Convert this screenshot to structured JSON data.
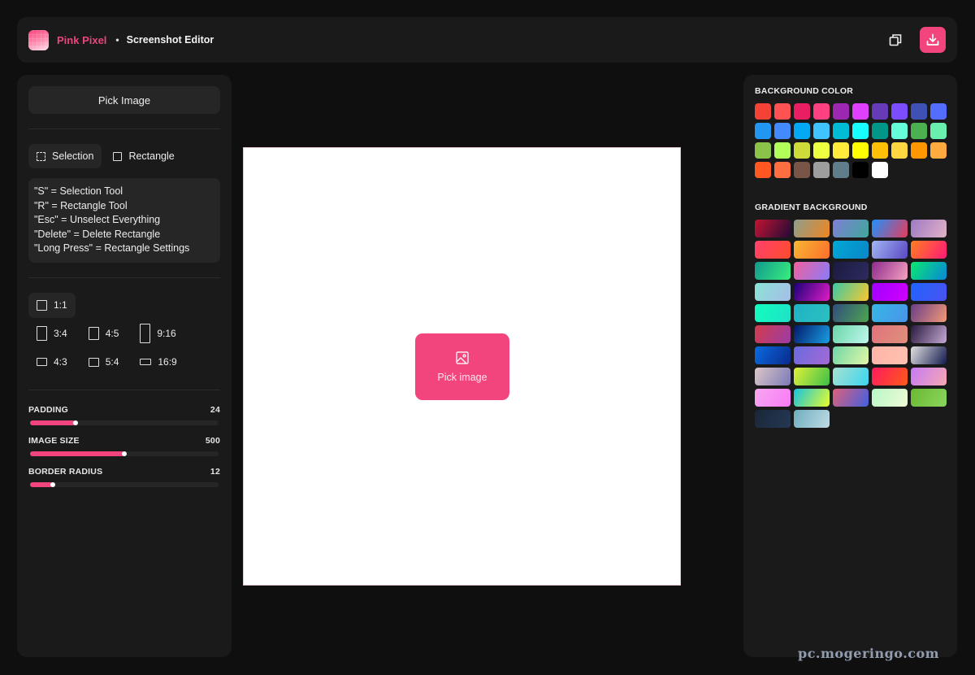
{
  "header": {
    "brand": "Pink Pixel",
    "separator": "•",
    "subtitle": "Screenshot Editor",
    "actions": [
      {
        "name": "copy-button",
        "icon": "copy-icon"
      },
      {
        "name": "download-button",
        "icon": "download-icon"
      }
    ]
  },
  "left_panel": {
    "pick_image_label": "Pick Image",
    "tools": [
      {
        "label": "Selection",
        "icon": "selection-icon",
        "active": true
      },
      {
        "label": "Rectangle",
        "icon": "rectangle-icon",
        "active": false
      }
    ],
    "shortcuts": [
      "\"S\" = Selection Tool",
      "\"R\" = Rectangle Tool",
      "\"Esc\" = Unselect Everything",
      "\"Delete\" = Delete Rectangle",
      "\"Long Press\" = Rectangle Settings"
    ],
    "aspect_ratios": [
      {
        "label": "1:1",
        "active": true
      },
      {
        "label": "3:4",
        "active": false
      },
      {
        "label": "4:5",
        "active": false
      },
      {
        "label": "9:16",
        "active": false
      },
      {
        "label": "4:3",
        "active": false
      },
      {
        "label": "5:4",
        "active": false
      },
      {
        "label": "16:9",
        "active": false
      }
    ],
    "sliders": [
      {
        "label": "PADDING",
        "value": "24",
        "fraction": 0.24
      },
      {
        "label": "IMAGE SIZE",
        "value": "500",
        "fraction": 0.5
      },
      {
        "label": "BORDER RADIUS",
        "value": "12",
        "fraction": 0.12
      }
    ]
  },
  "canvas": {
    "pick_label": "Pick image",
    "icon": "image-icon"
  },
  "right_panel": {
    "background_color_title": "BACKGROUND COLOR",
    "colors": [
      "#f44336",
      "#ff5252",
      "#e91e63",
      "#ff4081",
      "#9c27b0",
      "#e040fb",
      "#673ab7",
      "#7c4dff",
      "#3f51b5",
      "#536dfe",
      "#2196f3",
      "#448aff",
      "#03a9f4",
      "#40c4ff",
      "#00bcd4",
      "#18ffff",
      "#009688",
      "#64ffda",
      "#4caf50",
      "#69f0ae",
      "#8bc34a",
      "#b2ff59",
      "#cddc39",
      "#eeff41",
      "#ffeb3b",
      "#ffff00",
      "#ffc107",
      "#ffd740",
      "#ff9800",
      "#ffab40",
      "#ff5722",
      "#ff6e40",
      "#795548",
      "#9e9e9e",
      "#607d8b",
      "#000000",
      "#ffffff"
    ],
    "gradient_title": "GRADIENT BACKGROUND",
    "gradients": [
      [
        "#c31432",
        "#240b36"
      ],
      [
        "#8e9e8e",
        "#f0851f"
      ],
      [
        "#7f7fd5",
        "#3ea89a"
      ],
      [
        "#1e90ff",
        "#e73c5a"
      ],
      [
        "#9d7ac3",
        "#e3b2c8"
      ],
      [
        "#ff416c",
        "#ff4b2b"
      ],
      [
        "#f7b733",
        "#fc6e2b"
      ],
      [
        "#00a8d6",
        "#0b86c7"
      ],
      [
        "#a0b6f5",
        "#5b48c2"
      ],
      [
        "#ff7e20",
        "#ff1a78"
      ],
      [
        "#11998e",
        "#38ef7d"
      ],
      [
        "#f0609e",
        "#8a7cf7"
      ],
      [
        "#1a1a40",
        "#2e2b5e"
      ],
      [
        "#8e2a8e",
        "#f6a3c0"
      ],
      [
        "#0be871",
        "#0787d8"
      ],
      [
        "#89e3d6",
        "#a7bde8"
      ],
      [
        "#1a007a",
        "#e01cc4"
      ],
      [
        "#3bc9a5",
        "#fac82f"
      ],
      [
        "#a100ff",
        "#d100ff"
      ],
      [
        "#2064ff",
        "#4a52f0"
      ],
      [
        "#11ffbd",
        "#1fe0c8"
      ],
      [
        "#1fb3c5",
        "#2cc0c0"
      ],
      [
        "#314d7e",
        "#4da550"
      ],
      [
        "#35b8e6",
        "#4a93e8"
      ],
      [
        "#6a3d8a",
        "#f39a76"
      ],
      [
        "#d23c4c",
        "#9b3ca6"
      ],
      [
        "#031a6b",
        "#1a9ee3"
      ],
      [
        "#6bd6a8",
        "#bff7ee"
      ],
      [
        "#e0727a",
        "#e0907d"
      ],
      [
        "#2a1a3e",
        "#c4a8d4"
      ],
      [
        "#0a6ae0",
        "#0a2a8c"
      ],
      [
        "#6a6ae0",
        "#a46ad4"
      ],
      [
        "#6fd6a8",
        "#e3f7a8"
      ],
      [
        "#ffb4a8",
        "#ffc2b0"
      ],
      [
        "#e0e0e0",
        "#141a4e"
      ],
      [
        "#dcc6c6",
        "#7a7ab8"
      ],
      [
        "#e3f03a",
        "#3ac048"
      ],
      [
        "#a8e0d0",
        "#3ad6f0"
      ],
      [
        "#ff1a5e",
        "#ff5a1a"
      ],
      [
        "#c47af7",
        "#f7a8b0"
      ],
      [
        "#f7a8f0",
        "#f87af7"
      ],
      [
        "#16c3e0",
        "#eafc2a"
      ],
      [
        "#e0607a",
        "#4060e0"
      ],
      [
        "#b8f7c6",
        "#effad6"
      ],
      [
        "#6ab832",
        "#8ad65e"
      ],
      [
        "#1a2738",
        "#243854"
      ],
      [
        "#6eaebe",
        "#c0dbe6"
      ]
    ]
  }
}
